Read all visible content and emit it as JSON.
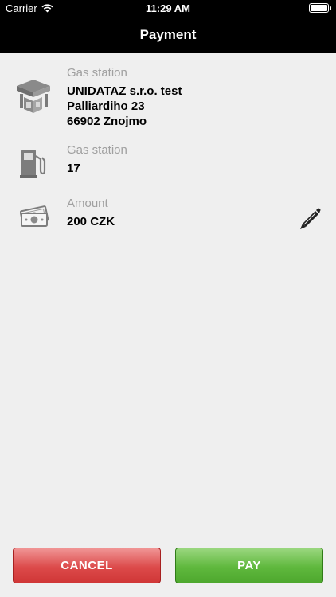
{
  "status_bar": {
    "carrier": "Carrier",
    "time": "11:29 AM"
  },
  "nav": {
    "title": "Payment"
  },
  "rows": [
    {
      "icon": "gas-station-building-icon",
      "label": "Gas station",
      "lines": [
        "UNIDATAZ s.r.o. test",
        "Palliardiho 23",
        "66902 Znojmo"
      ]
    },
    {
      "icon": "fuel-pump-icon",
      "label": "Gas station",
      "lines": [
        "17"
      ]
    },
    {
      "icon": "money-icon",
      "label": "Amount",
      "lines": [
        "200 CZK"
      ]
    }
  ],
  "edit_icon": "pencil-icon",
  "buttons": {
    "cancel": "CANCEL",
    "pay": "PAY"
  },
  "colors": {
    "cancel": "#d94444",
    "pay": "#5cb53a",
    "nav_bg": "#000000",
    "page_bg": "#efefef"
  }
}
